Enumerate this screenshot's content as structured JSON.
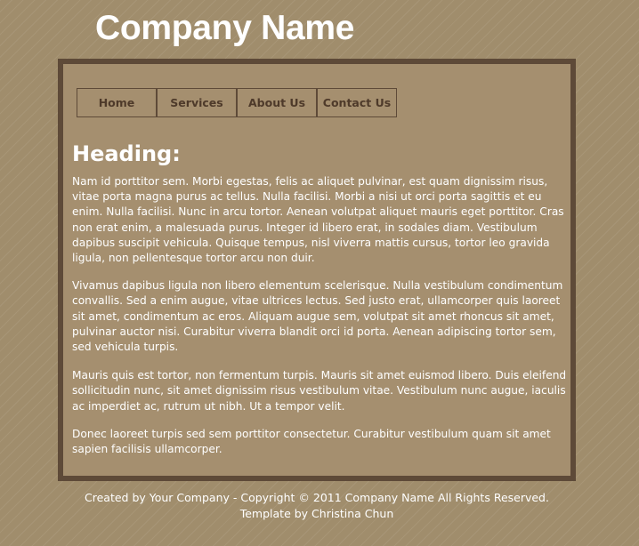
{
  "site": {
    "title": "Company Name"
  },
  "nav": {
    "items": [
      {
        "label": "Home"
      },
      {
        "label": "Services"
      },
      {
        "label": "About Us"
      },
      {
        "label": "Contact Us"
      }
    ]
  },
  "main": {
    "heading": "Heading:",
    "paragraphs": [
      "Nam id porttitor sem. Morbi egestas, felis ac aliquet pulvinar, est quam dignissim risus, vitae porta magna purus ac tellus. Nulla facilisi. Morbi a nisi ut orci porta sagittis et eu enim. Nulla facilisi. Nunc in arcu tortor. Aenean volutpat aliquet mauris eget porttitor. Cras non erat enim, a malesuada purus. Integer id libero erat, in sodales diam. Vestibulum dapibus suscipit vehicula. Quisque tempus, nisl viverra mattis cursus, tortor leo gravida ligula, non pellentesque tortor arcu non duir.",
      "Vivamus dapibus ligula non libero elementum scelerisque. Nulla vestibulum condimentum convallis. Sed a enim augue, vitae ultrices lectus. Sed justo erat, ullamcorper quis laoreet sit amet, condimentum ac eros. Aliquam augue sem, volutpat sit amet rhoncus sit amet, pulvinar auctor nisi. Curabitur viverra blandit orci id porta. Aenean adipiscing tortor sem, sed vehicula turpis.",
      "Mauris quis est tortor, non fermentum turpis. Mauris sit amet euismod libero. Duis eleifend sollicitudin nunc, sit amet dignissim risus vestibulum vitae. Vestibulum nunc augue, iaculis ac imperdiet ac, rutrum ut nibh. Ut a tempor velit.",
      "Donec laoreet turpis sed sem porttitor consectetur. Curabitur vestibulum quam sit amet sapien facilisis ullamcorper."
    ]
  },
  "footer": {
    "copyright": "Created by Your Company - Copyright © 2011 Company Name All Rights Reserved.",
    "credit": "Template by Christina Chun"
  },
  "colors": {
    "background": "#a08d6c",
    "content_background": "#a58f6f",
    "border": "#5e4a38",
    "nav_text": "#4e3a2a",
    "text": "#ffffff"
  }
}
